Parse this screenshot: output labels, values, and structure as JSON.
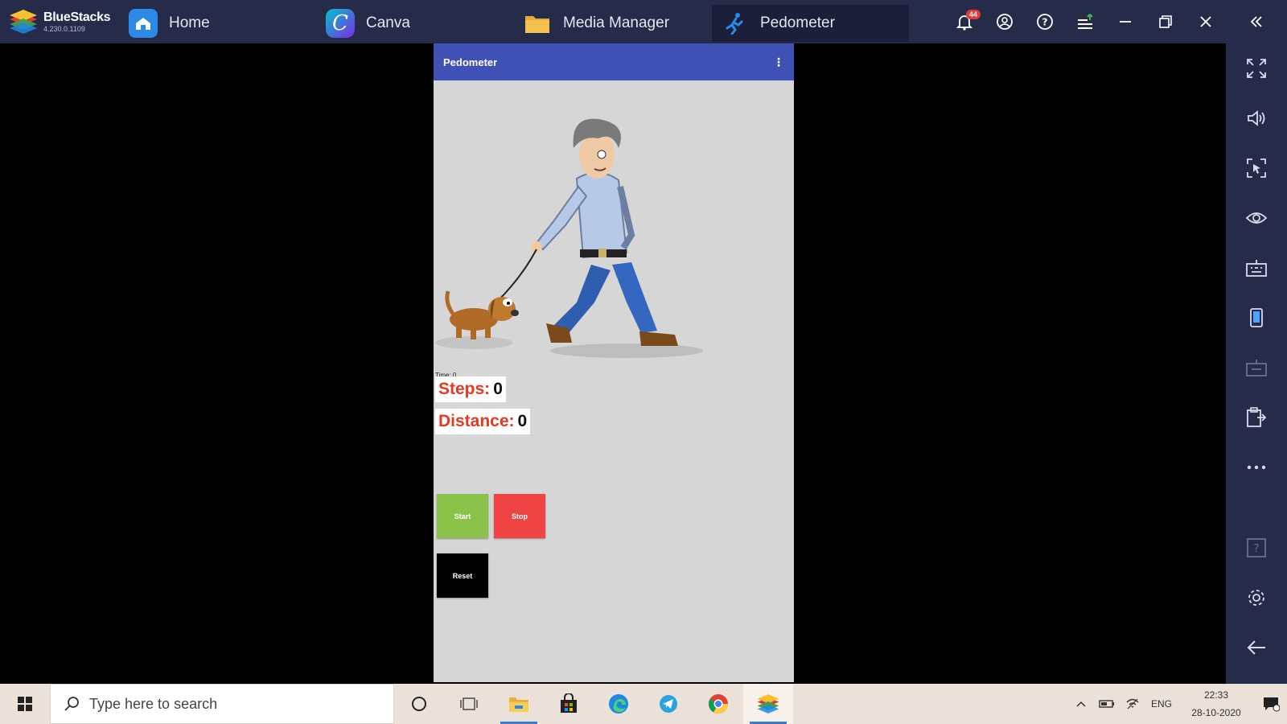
{
  "window": {
    "app_name": "BlueStacks",
    "version": "4.230.0.1109",
    "tabs": [
      {
        "label": "Home",
        "icon": "home-icon",
        "color": "#2b8ae6"
      },
      {
        "label": "Canva",
        "icon": "canva-icon",
        "color": "#7d2ae8"
      },
      {
        "label": "Media Manager",
        "icon": "folder-icon",
        "color": "#f2c14e"
      },
      {
        "label": "Pedometer",
        "icon": "runner-icon",
        "color": "#2b8ae6"
      }
    ],
    "notification_count": "44"
  },
  "app": {
    "title": "Pedometer",
    "menu_label": "⋮",
    "time_label": "Time: 0",
    "steps_key": "Steps:",
    "steps_value": "0",
    "distance_key": "Distance:",
    "distance_value": "0",
    "start_label": "Start",
    "stop_label": "Stop",
    "reset_label": "Reset"
  },
  "taskbar": {
    "search_placeholder": "Type here to search",
    "language": "ENG",
    "time": "22:33",
    "date": "28-10-2020"
  },
  "colors": {
    "titlebar": "#262b4a",
    "app_bar": "#3f51b5",
    "start": "#8bc34a",
    "stop": "#ef4444",
    "reset": "#000000",
    "label_red": "#e53920"
  }
}
